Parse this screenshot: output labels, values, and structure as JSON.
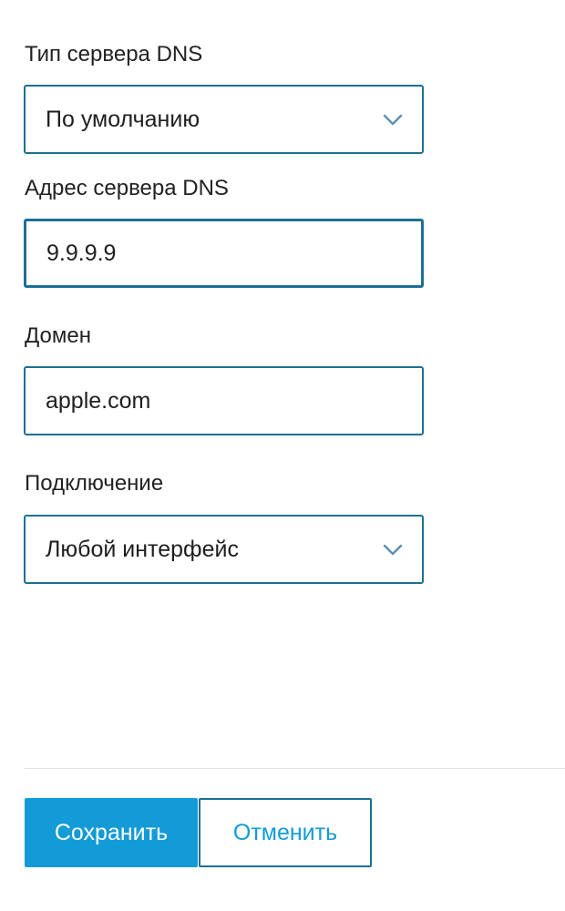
{
  "form": {
    "dns_type": {
      "label": "Тип сервера DNS",
      "value": "По умолчанию"
    },
    "dns_address": {
      "label": "Адрес сервера DNS",
      "value": "9.9.9.9"
    },
    "domain": {
      "label": "Домен",
      "value": "apple.com"
    },
    "connection": {
      "label": "Подключение",
      "value": "Любой интерфейс"
    }
  },
  "actions": {
    "save_label": "Сохранить",
    "cancel_label": "Отменить"
  },
  "colors": {
    "accent": "#139bd7",
    "border": "#1d6f96",
    "chevron": "#5a8fb0",
    "divider": "#e3e3e3"
  },
  "icons": {
    "dropdown": "chevron-down-icon"
  }
}
